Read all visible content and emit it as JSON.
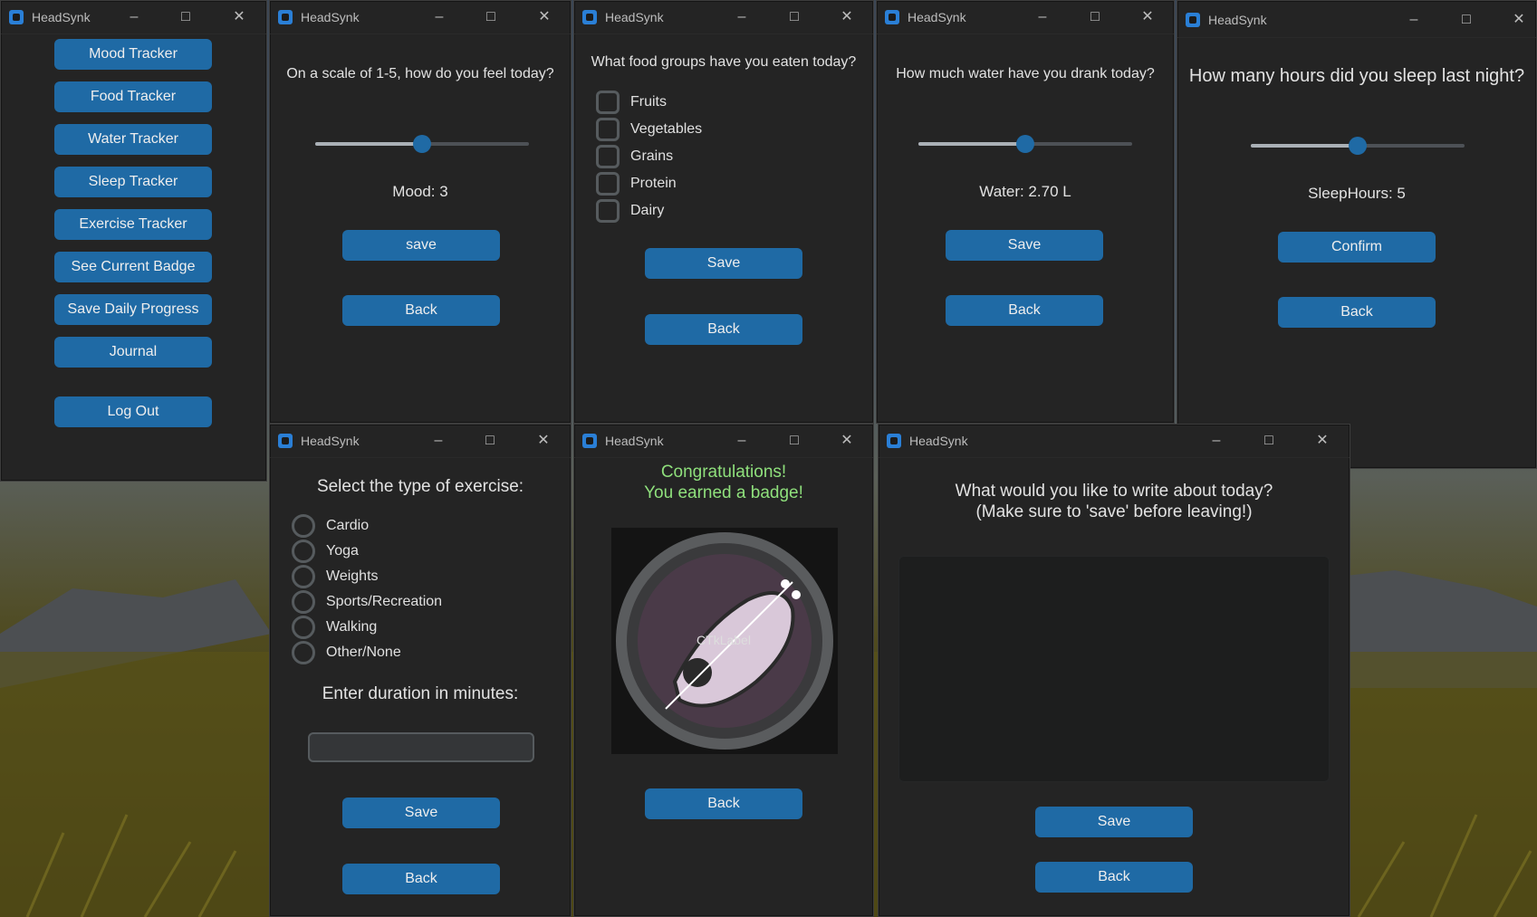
{
  "app_title": "HeadSynk",
  "menu": {
    "items": [
      "Mood Tracker",
      "Food Tracker",
      "Water Tracker",
      "Sleep Tracker",
      "Exercise Tracker",
      "See Current Badge",
      "Save Daily Progress",
      "Journal"
    ],
    "logout": "Log Out"
  },
  "mood": {
    "question": "On a scale of 1-5, how do you feel today?",
    "slider_fraction": 0.5,
    "value_text": "Mood: 3",
    "save": "save",
    "back": "Back"
  },
  "food": {
    "question": "What food groups have you eaten today?",
    "options": [
      "Fruits",
      "Vegetables",
      "Grains",
      "Protein",
      "Dairy"
    ],
    "save": "Save",
    "back": "Back"
  },
  "water": {
    "question": "How much water have you drank today?",
    "slider_fraction": 0.5,
    "value_text": "Water: 2.70 L",
    "save": "Save",
    "back": "Back"
  },
  "sleep": {
    "question": "How many hours did you sleep last night?",
    "slider_fraction": 0.5,
    "value_text": "SleepHours: 5",
    "confirm": "Confirm",
    "back": "Back"
  },
  "exercise": {
    "question": "Select the type of exercise:",
    "options": [
      "Cardio",
      "Yoga",
      "Weights",
      "Sports/Recreation",
      "Walking",
      "Other/None"
    ],
    "duration_label": "Enter duration in minutes:",
    "duration_value": "",
    "save": "Save",
    "back": "Back"
  },
  "badge": {
    "line1": "Congratulations!",
    "line2": "You earned a badge!",
    "image_label": "CTkLabel",
    "back": "Back"
  },
  "journal": {
    "line1": "What would you like to write about today?",
    "line2": "(Make sure to 'save' before leaving!)",
    "text": "",
    "save": "Save",
    "back": "Back"
  },
  "colors": {
    "accent": "#1f6aa5",
    "window_bg": "#242424",
    "congrats": "#8fe07c"
  }
}
